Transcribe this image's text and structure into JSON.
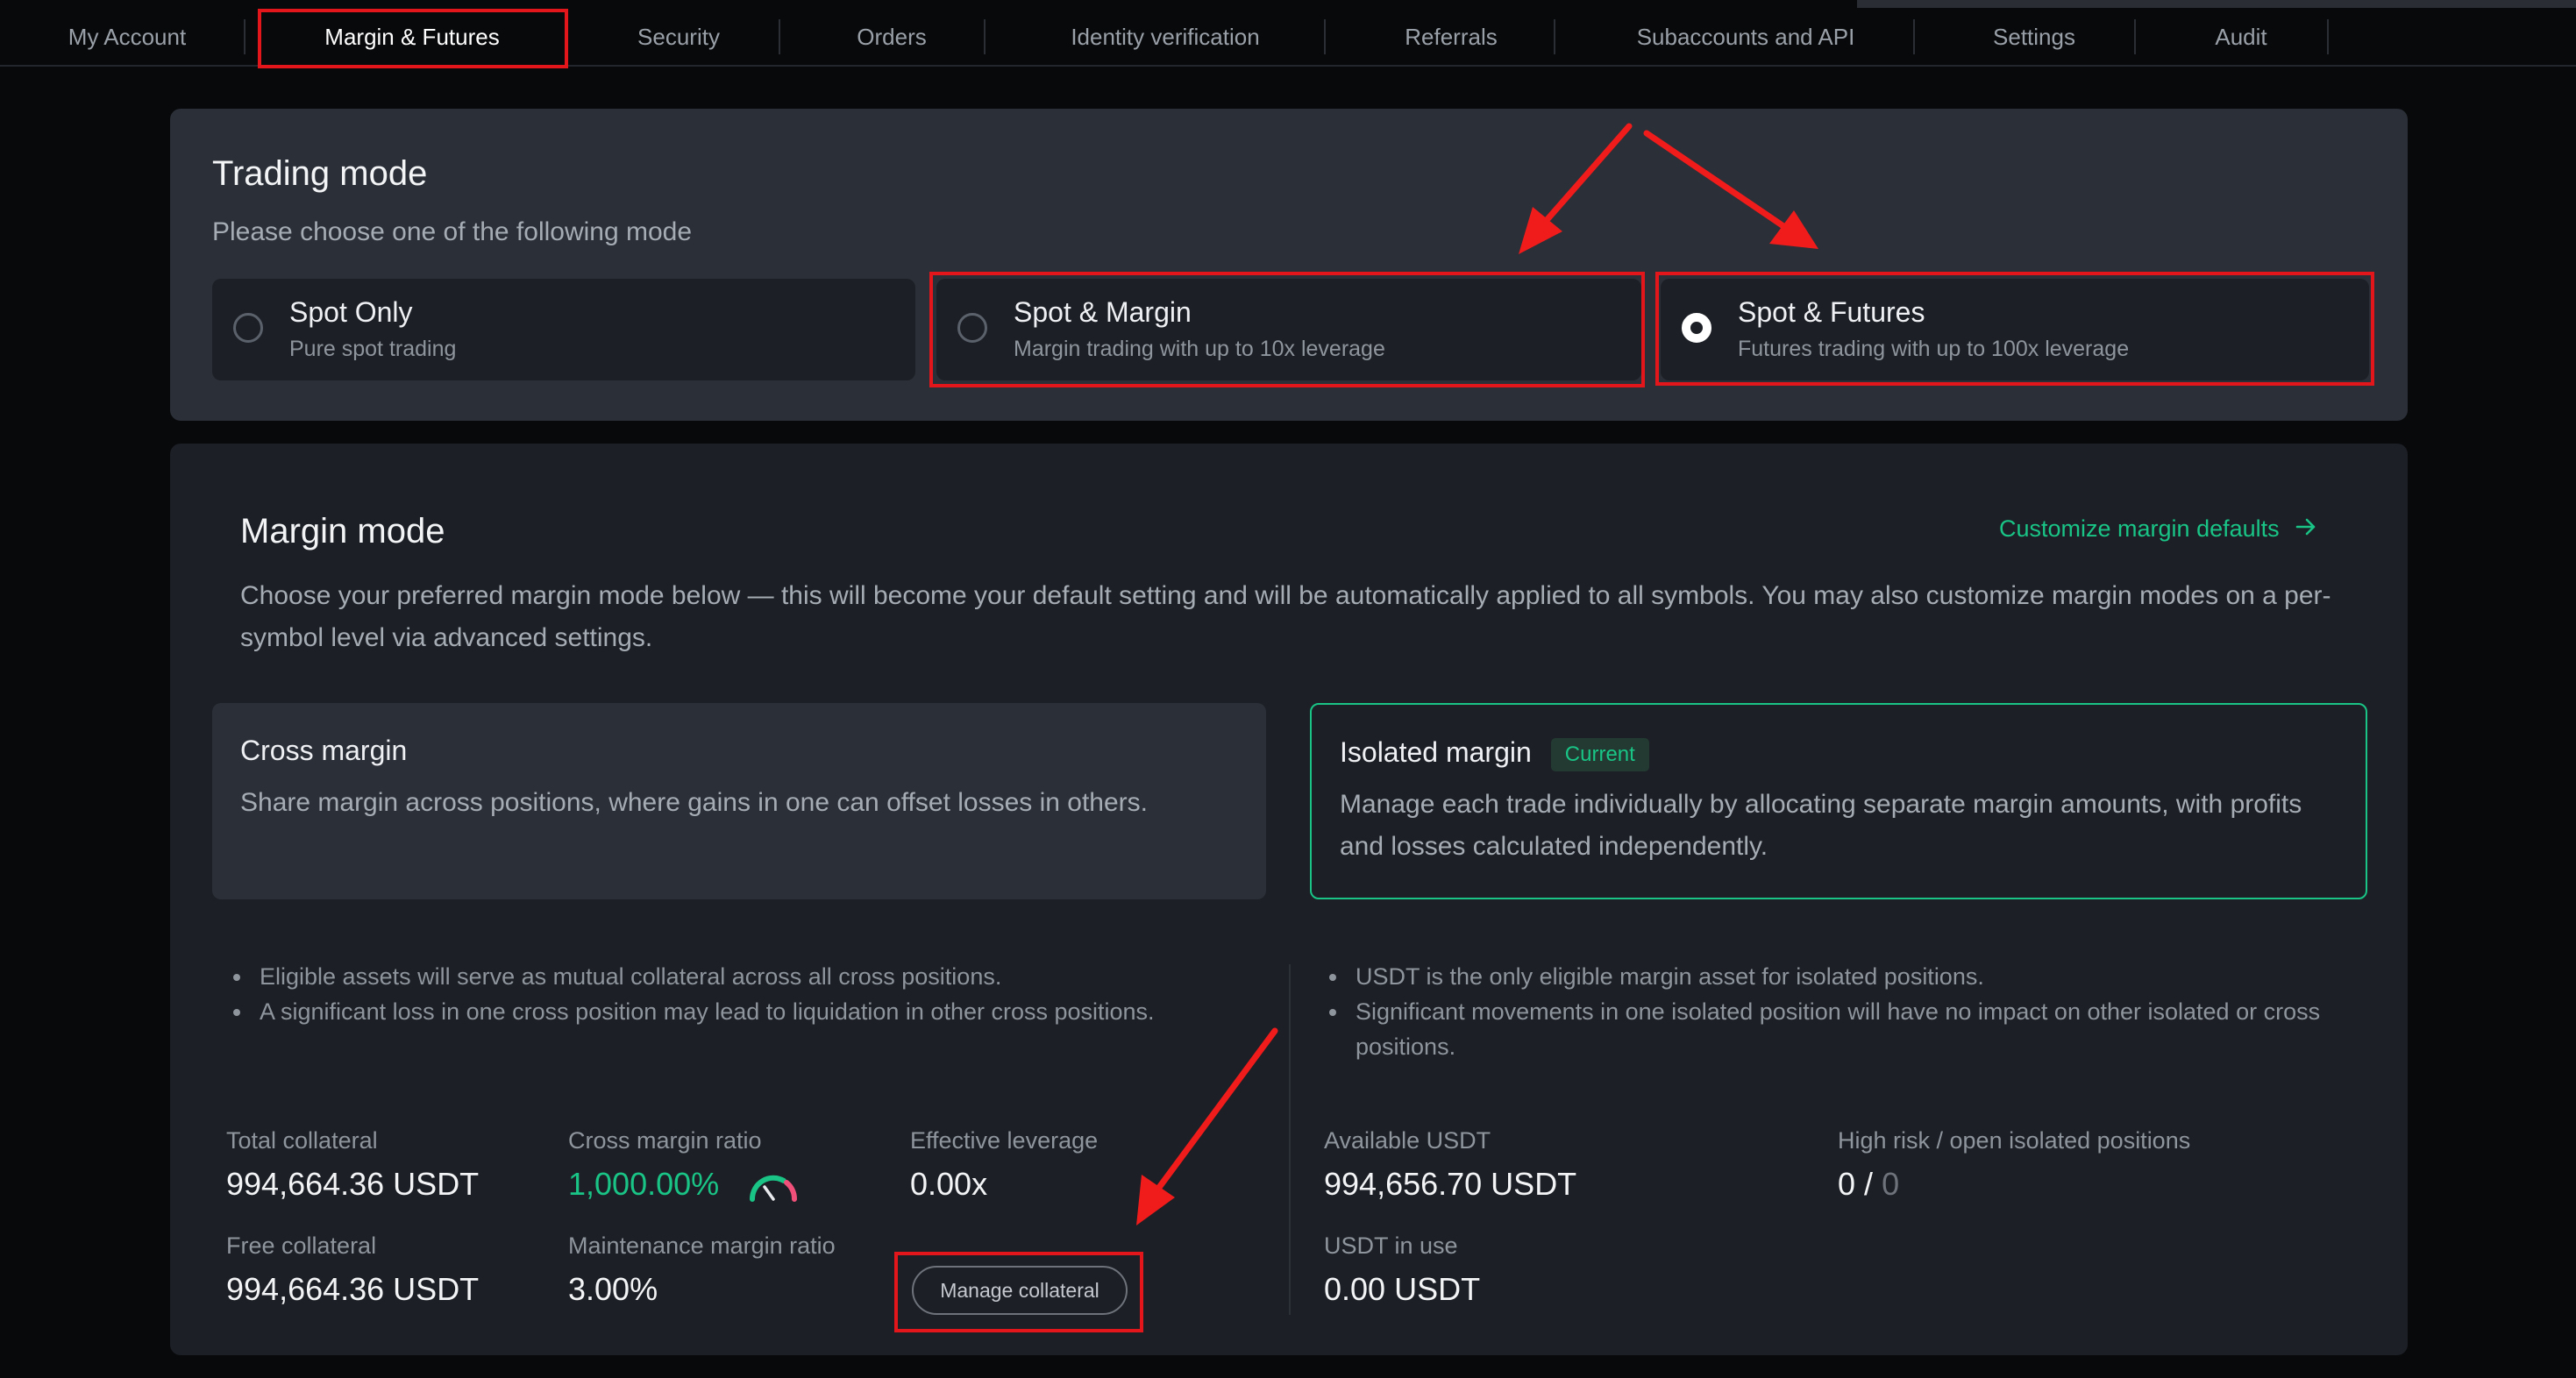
{
  "nav": {
    "tabs": [
      {
        "label": "My Account"
      },
      {
        "label": "Margin & Futures"
      },
      {
        "label": "Security"
      },
      {
        "label": "Orders"
      },
      {
        "label": "Identity verification"
      },
      {
        "label": "Referrals"
      },
      {
        "label": "Subaccounts and API"
      },
      {
        "label": "Settings"
      },
      {
        "label": "Audit"
      }
    ],
    "active_tab": "Margin & Futures"
  },
  "trading_mode": {
    "title": "Trading mode",
    "subtitle": "Please choose one of the following mode",
    "options": [
      {
        "title": "Spot Only",
        "desc": "Pure spot trading",
        "selected": false
      },
      {
        "title": "Spot & Margin",
        "desc": "Margin trading with up to 10x leverage",
        "selected": false
      },
      {
        "title": "Spot & Futures",
        "desc": "Futures trading with up to 100x leverage",
        "selected": true
      }
    ]
  },
  "margin_mode": {
    "title": "Margin mode",
    "customize_link": "Customize margin defaults",
    "description": "Choose your preferred margin mode below — this will become your default setting and will be automatically applied to all symbols. You may also customize margin modes on a per-symbol level via advanced settings.",
    "cross": {
      "title": "Cross margin",
      "desc": "Share margin across positions, where gains in one can offset losses in others.",
      "bullets": [
        "Eligible assets will serve as mutual collateral across all cross positions.",
        "A significant loss in one cross position may lead to liquidation in other cross positions."
      ],
      "stats": {
        "total_collateral_label": "Total collateral",
        "total_collateral": "994,664.36 USDT",
        "free_collateral_label": "Free collateral",
        "free_collateral": "994,664.36 USDT",
        "cross_margin_ratio_label": "Cross margin ratio",
        "cross_margin_ratio": "1,000.00%",
        "maintenance_margin_ratio_label": "Maintenance margin ratio",
        "maintenance_margin_ratio": "3.00%",
        "effective_leverage_label": "Effective leverage",
        "effective_leverage": "0.00x",
        "manage_button": "Manage collateral"
      }
    },
    "isolated": {
      "title": "Isolated margin",
      "badge": "Current",
      "desc": "Manage each trade individually by allocating separate margin amounts, with profits and losses calculated independently.",
      "bullets": [
        "USDT is the only eligible margin asset for isolated positions.",
        "Significant movements in one isolated position will have no impact on other isolated or cross positions."
      ],
      "stats": {
        "available_label": "Available USDT",
        "available": "994,656.70 USDT",
        "in_use_label": "USDT in use",
        "in_use": "0.00 USDT",
        "high_risk_label": "High risk / open isolated positions",
        "high_risk": "0",
        "separator": "/",
        "open_positions": "0"
      }
    }
  },
  "colors": {
    "accent_green": "#19c486",
    "highlight_red": "#e3161b",
    "annotation_arrow": "#f01c1c"
  }
}
